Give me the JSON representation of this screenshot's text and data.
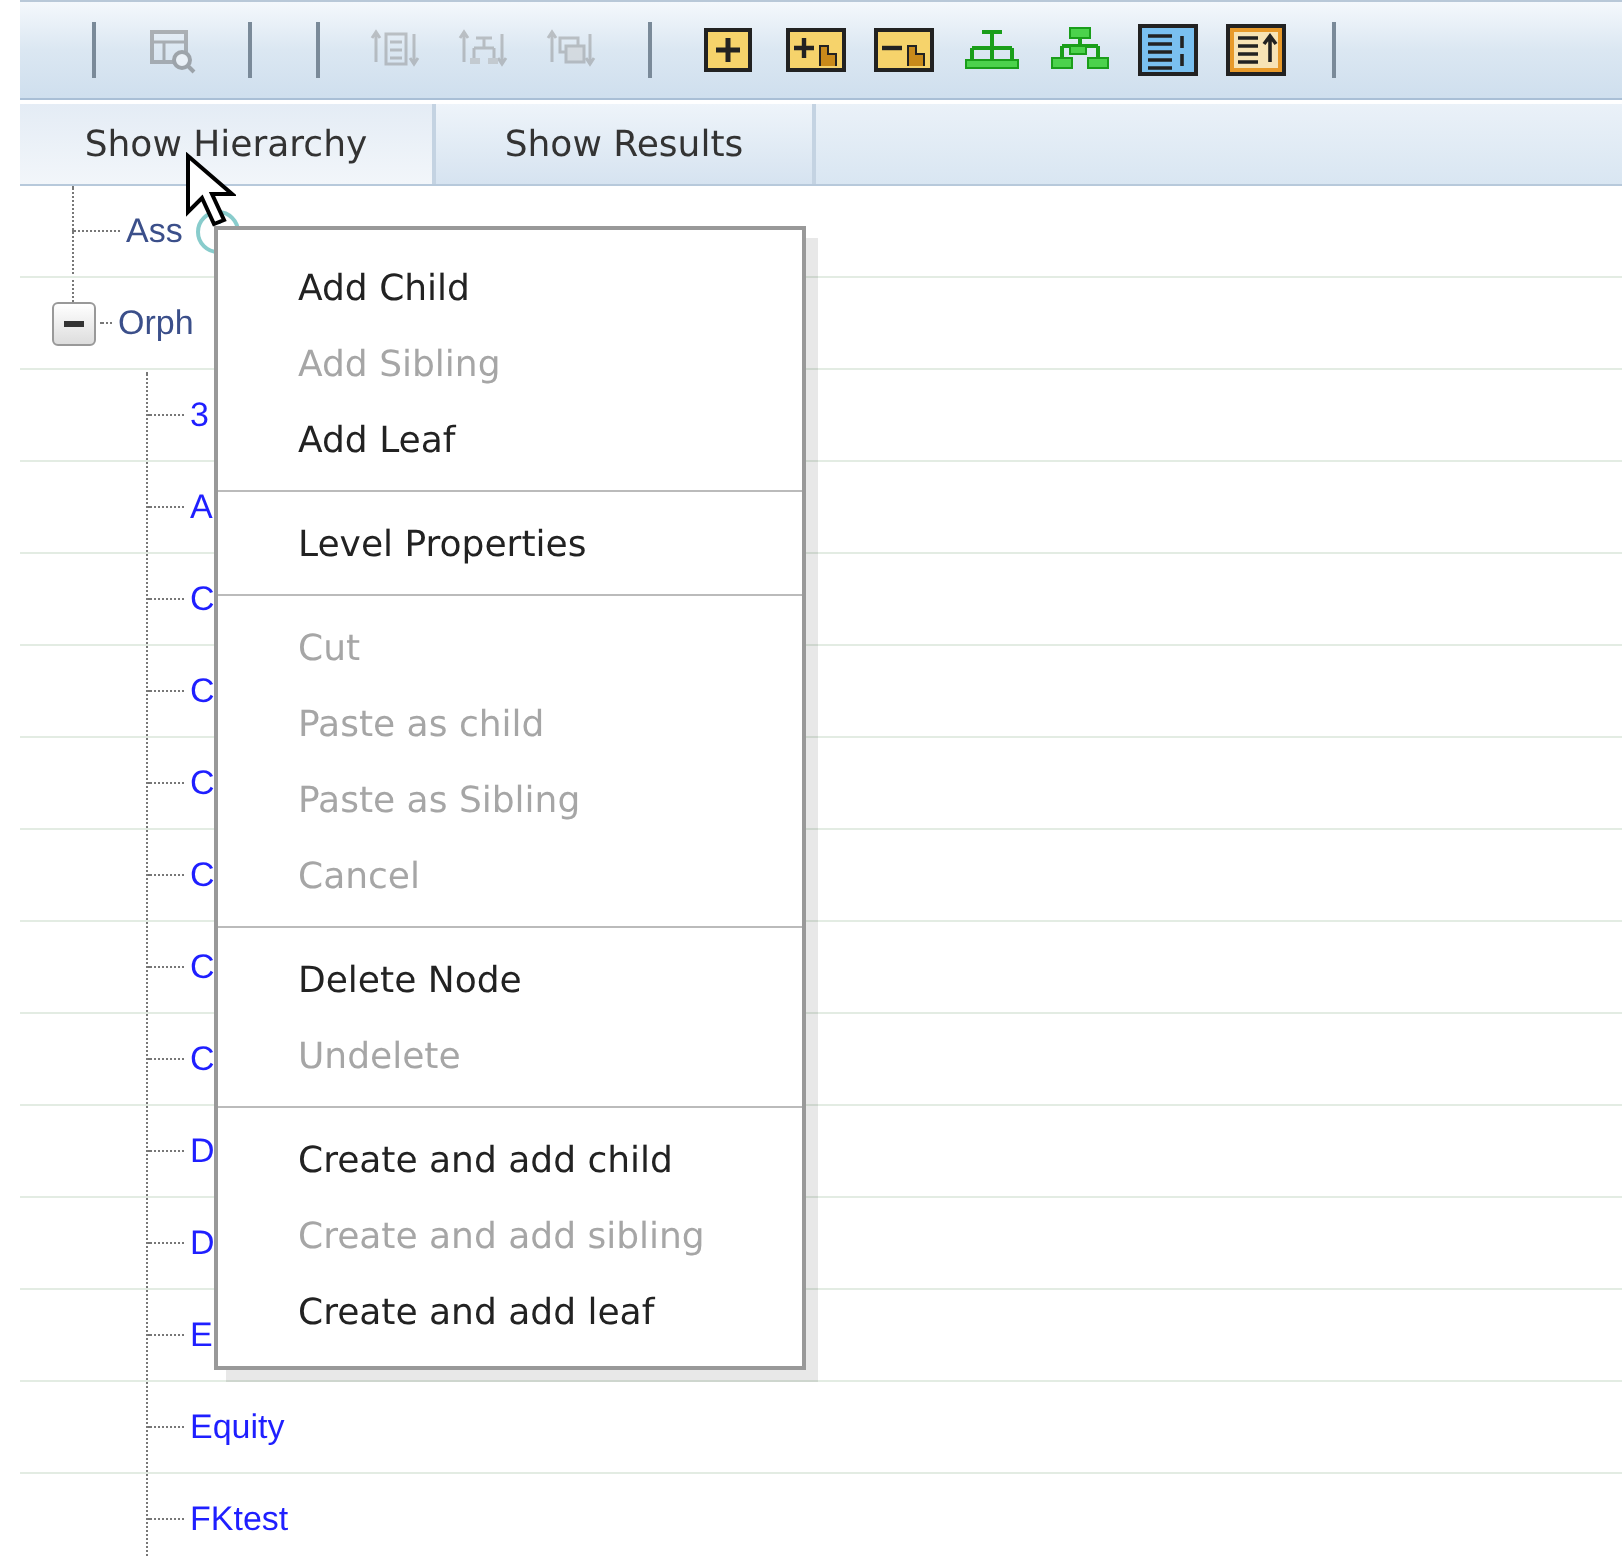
{
  "toolbar": [
    {
      "kind": "separator"
    },
    {
      "kind": "button",
      "disabled": true
    },
    {
      "kind": "separator"
    },
    {
      "kind": "separator"
    },
    {
      "kind": "button",
      "disabled": true
    },
    {
      "kind": "button",
      "disabled": true
    },
    {
      "kind": "button",
      "disabled": true
    },
    {
      "kind": "separator"
    },
    {
      "kind": "button",
      "disabled": false
    },
    {
      "kind": "button",
      "disabled": false
    },
    {
      "kind": "button",
      "disabled": false
    },
    {
      "kind": "button",
      "disabled": false
    },
    {
      "kind": "button",
      "disabled": false
    },
    {
      "kind": "button",
      "disabled": false
    },
    {
      "kind": "button",
      "disabled": false
    },
    {
      "kind": "separator"
    }
  ],
  "tabs": [
    {
      "label": "Show Hierarchy",
      "selected": true
    },
    {
      "label": "Show Results",
      "selected": false
    }
  ],
  "tree": [
    {
      "label": "Ass",
      "info": true
    },
    {
      "label": "Orph",
      "expanded": true,
      "children": [
        {
          "label": "3"
        },
        {
          "label": "A"
        },
        {
          "label": "C"
        },
        {
          "label": "C"
        },
        {
          "label": "C"
        },
        {
          "label": "C"
        },
        {
          "label": "C"
        },
        {
          "label": "C"
        },
        {
          "label": "D"
        },
        {
          "label": "D"
        },
        {
          "label": "E"
        },
        {
          "label": "Equity"
        },
        {
          "label": "FKtest"
        }
      ]
    }
  ],
  "context_menu": [
    {
      "kind": "item",
      "label": "Add Child",
      "disabled": false
    },
    {
      "kind": "item",
      "label": "Add Sibling",
      "disabled": true
    },
    {
      "kind": "item",
      "label": "Add Leaf",
      "disabled": false
    },
    {
      "kind": "separator"
    },
    {
      "kind": "item",
      "label": "Level Properties",
      "disabled": false
    },
    {
      "kind": "separator"
    },
    {
      "kind": "item",
      "label": "Cut",
      "disabled": true
    },
    {
      "kind": "item",
      "label": "Paste as child",
      "disabled": true
    },
    {
      "kind": "item",
      "label": "Paste as Sibling",
      "disabled": true
    },
    {
      "kind": "item",
      "label": "Cancel",
      "disabled": true
    },
    {
      "kind": "separator"
    },
    {
      "kind": "item",
      "label": "Delete Node",
      "disabled": false
    },
    {
      "kind": "item",
      "label": "Undelete",
      "disabled": true
    },
    {
      "kind": "separator"
    },
    {
      "kind": "item",
      "label": "Create and add child",
      "disabled": false
    },
    {
      "kind": "item",
      "label": "Create and add sibling",
      "disabled": true
    },
    {
      "kind": "item",
      "label": "Create and add leaf",
      "disabled": false
    }
  ]
}
